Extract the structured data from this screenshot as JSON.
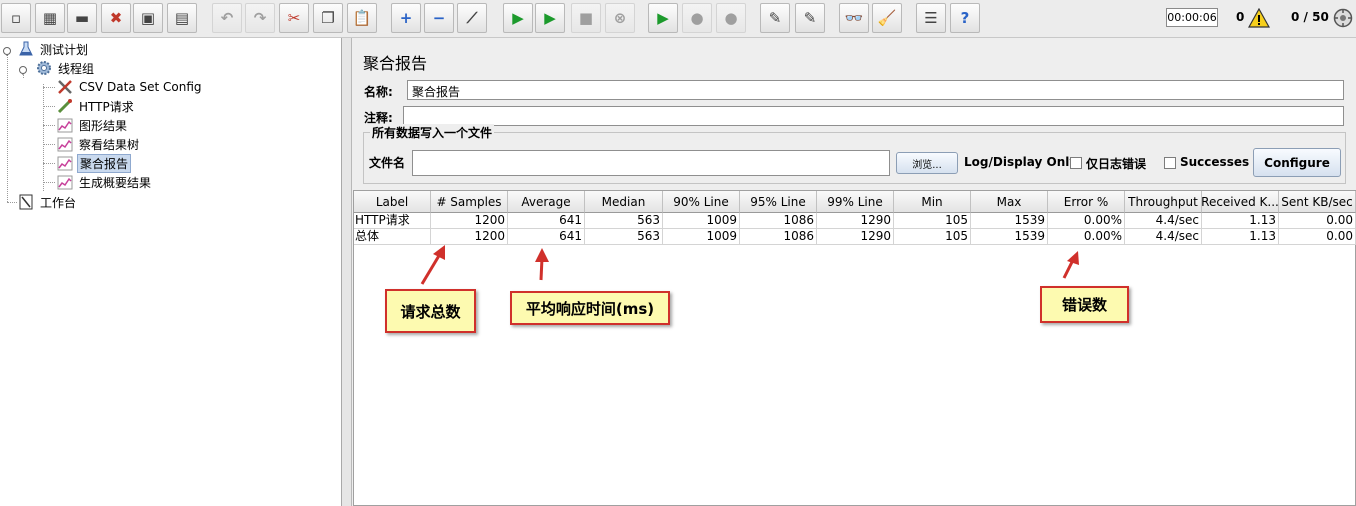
{
  "toolbar": {
    "buttons": [
      {
        "name": "new-icon",
        "glyph": "▫",
        "disabled": false
      },
      {
        "name": "templates-icon",
        "glyph": "▦",
        "disabled": false
      },
      {
        "name": "open-icon",
        "glyph": "▬",
        "disabled": false
      },
      {
        "name": "close-icon",
        "glyph": "✖",
        "disabled": false
      },
      {
        "name": "save-icon",
        "glyph": "▣",
        "disabled": false
      },
      {
        "name": "save-as-icon",
        "glyph": "▤",
        "disabled": false
      },
      {
        "name": "undo-icon",
        "glyph": "↶",
        "disabled": true
      },
      {
        "name": "redo-icon",
        "glyph": "↷",
        "disabled": true
      },
      {
        "name": "cut-icon",
        "glyph": "✂",
        "disabled": false
      },
      {
        "name": "copy-icon",
        "glyph": "❐",
        "disabled": false
      },
      {
        "name": "paste-icon",
        "glyph": "📋",
        "disabled": false
      },
      {
        "name": "expand-icon",
        "glyph": "+",
        "disabled": false
      },
      {
        "name": "collapse-icon",
        "glyph": "−",
        "disabled": false
      },
      {
        "name": "toggle-icon",
        "glyph": "⟋",
        "disabled": false
      },
      {
        "name": "start-icon",
        "glyph": "▶",
        "disabled": false
      },
      {
        "name": "start-no-pause-icon",
        "glyph": "▶",
        "disabled": false
      },
      {
        "name": "stop-icon",
        "glyph": "■",
        "disabled": true
      },
      {
        "name": "shutdown-icon",
        "glyph": "⊗",
        "disabled": true
      },
      {
        "name": "remote-start-icon",
        "glyph": "▶",
        "disabled": false
      },
      {
        "name": "remote-stop-icon",
        "glyph": "●",
        "disabled": true
      },
      {
        "name": "remote-shutdown-icon",
        "glyph": "●",
        "disabled": true
      },
      {
        "name": "clear-icon",
        "glyph": "✎",
        "disabled": false
      },
      {
        "name": "clear-all-icon",
        "glyph": "✎",
        "disabled": false
      },
      {
        "name": "search-icon",
        "glyph": "👓",
        "disabled": false
      },
      {
        "name": "reset-search-icon",
        "glyph": "🧹",
        "disabled": false
      },
      {
        "name": "function-helper-icon",
        "glyph": "☰",
        "disabled": false
      },
      {
        "name": "help-icon",
        "glyph": "?",
        "disabled": false
      }
    ],
    "timer": "00:00:06",
    "warning_count": "0",
    "threads": "0 / 50"
  },
  "tree": {
    "nodes": [
      {
        "label": "测试计划",
        "icon": "flask-icon"
      },
      {
        "label": "线程组",
        "icon": "gear-icon"
      },
      {
        "label": "CSV Data Set Config",
        "icon": "tools-icon"
      },
      {
        "label": "HTTP请求",
        "icon": "pipette-icon"
      },
      {
        "label": "图形结果",
        "icon": "graph-icon"
      },
      {
        "label": "察看结果树",
        "icon": "graph-icon"
      },
      {
        "label": "聚合报告",
        "icon": "graph-icon"
      },
      {
        "label": "生成概要结果",
        "icon": "graph-icon"
      },
      {
        "label": "工作台",
        "icon": "workbench-icon"
      }
    ]
  },
  "panel": {
    "title": "聚合报告",
    "name_label": "名称:",
    "name_value": "聚合报告",
    "comment_label": "注释:",
    "comment_value": "",
    "file_group_title": "所有数据写入一个文件",
    "filename_label": "文件名",
    "filename_value": "",
    "browse_label": "浏览...",
    "log_display_label": "Log/Display Only:",
    "errors_only_label": "仅日志错误",
    "successes_label": "Successes",
    "configure_label": "Configure"
  },
  "table": {
    "columns": [
      "Label",
      "# Samples",
      "Average",
      "Median",
      "90% Line",
      "95% Line",
      "99% Line",
      "Min",
      "Max",
      "Error %",
      "Throughput",
      "Received K...",
      "Sent KB/sec"
    ],
    "rows": [
      [
        "HTTP请求",
        "1200",
        "641",
        "563",
        "1009",
        "1086",
        "1290",
        "105",
        "1539",
        "0.00%",
        "4.4/sec",
        "1.13",
        "0.00"
      ],
      [
        "总体",
        "1200",
        "641",
        "563",
        "1009",
        "1086",
        "1290",
        "105",
        "1539",
        "0.00%",
        "4.4/sec",
        "1.13",
        "0.00"
      ]
    ]
  },
  "annotations": {
    "samples_note": "请求总数",
    "average_note": "平均响应时间(ms)",
    "error_note": "错误数",
    "border_color": "#d0302b",
    "fill_color": "#fdfab0"
  }
}
